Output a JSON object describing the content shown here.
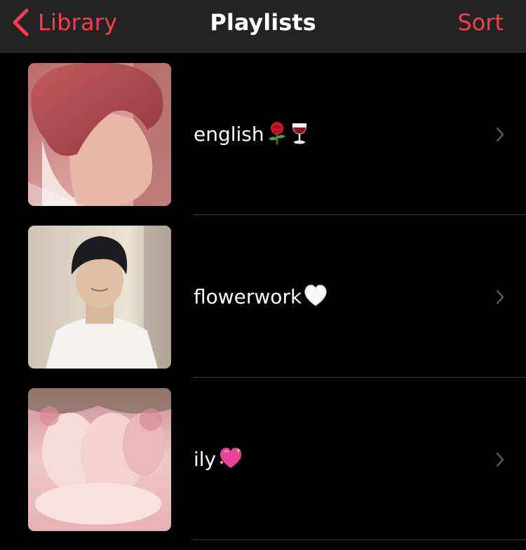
{
  "nav": {
    "back_label": "Library",
    "title": "Playlists",
    "sort_label": "Sort",
    "accent_color": "#fa3c4c"
  },
  "playlists": [
    {
      "name": "english",
      "emoji_icons": [
        "rose-emoji-icon",
        "wine-glass-emoji-icon"
      ]
    },
    {
      "name": "flowerwork",
      "emoji_icons": [
        "white-heart-emoji-icon"
      ]
    },
    {
      "name": "ily",
      "emoji_icons": [
        "sparkling-heart-emoji-icon"
      ]
    }
  ]
}
